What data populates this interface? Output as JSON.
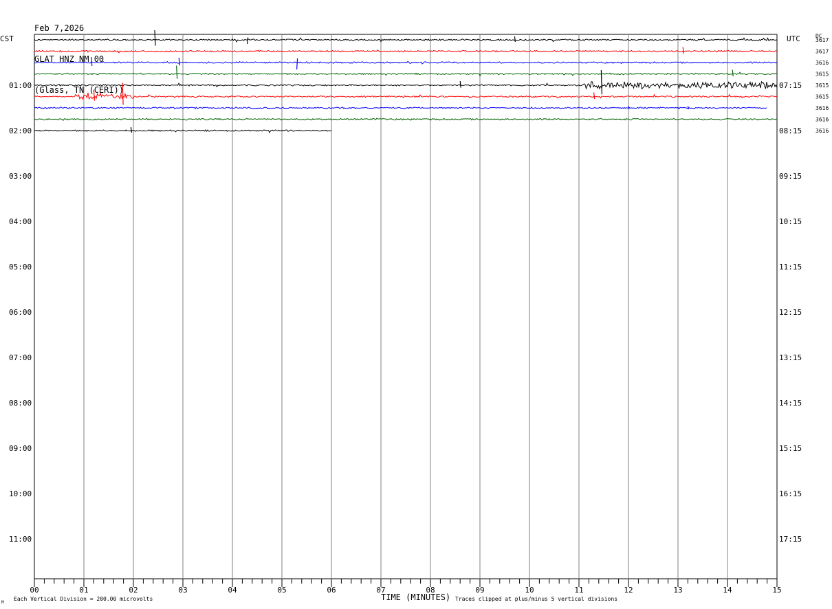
{
  "header": {
    "date": "Feb 7,2026",
    "station": "GLAT HNZ NM 00",
    "location": "(Glass, TN (CERI))"
  },
  "left_tz_label": "CST",
  "right_tz_label": "UTC",
  "dc_label": "DC",
  "x_axis_title": "TIME (MINUTES)",
  "footnote_left": "Each Vertical Division =  200.00 microvolts",
  "footnote_right": "Traces clipped at plus/minus 5 vertical divisions",
  "colors": {
    "black": "#000000",
    "red": "#ff0000",
    "blue": "#0000ff",
    "green": "#006400",
    "grid": "#808080"
  },
  "chart_data": {
    "type": "line",
    "xlabel": "TIME (MINUTES)",
    "xlim": [
      0,
      15
    ],
    "x_ticks": [
      "00",
      "01",
      "02",
      "03",
      "04",
      "05",
      "06",
      "07",
      "08",
      "09",
      "10",
      "11",
      "12",
      "13",
      "14",
      "15"
    ],
    "left_hour_labels": [
      "01:00",
      "02:00",
      "03:00",
      "04:00",
      "05:00",
      "06:00",
      "07:00",
      "08:00",
      "09:00",
      "10:00",
      "11:00"
    ],
    "right_hour_labels": [
      "07:15",
      "08:15",
      "09:15",
      "10:15",
      "11:15",
      "12:15",
      "13:15",
      "14:15",
      "15:15",
      "16:15",
      "17:15"
    ],
    "trace_colors": [
      "black",
      "red",
      "blue",
      "green"
    ],
    "traces": [
      {
        "row": 0,
        "color": "black",
        "dc": "3617",
        "end_minute": 15,
        "events": [
          {
            "t": 2.43,
            "a": 14
          },
          {
            "t": 4.3,
            "a": -6
          },
          {
            "t": 9.7,
            "a": 5
          }
        ]
      },
      {
        "row": 1,
        "color": "red",
        "dc": "3617",
        "end_minute": 15,
        "events": [
          {
            "t": 13.1,
            "a": 6
          }
        ]
      },
      {
        "row": 2,
        "color": "blue",
        "dc": "3616",
        "end_minute": 15,
        "events": [
          {
            "t": 1.15,
            "a": 8
          },
          {
            "t": 2.92,
            "a": 7
          },
          {
            "t": 5.3,
            "a": -10
          }
        ]
      },
      {
        "row": 3,
        "color": "green",
        "dc": "3615",
        "end_minute": 15,
        "events": [
          {
            "t": 2.87,
            "a": 12
          },
          {
            "t": 14.1,
            "a": 6
          }
        ]
      },
      {
        "row": 4,
        "color": "black",
        "dc": "3615",
        "end_minute": 15,
        "events": [
          {
            "t": 8.6,
            "a": 6
          },
          {
            "t": 11.45,
            "a": 22
          }
        ],
        "burst": [
          11.1,
          15
        ]
      },
      {
        "row": 5,
        "color": "red",
        "dc": "3615",
        "end_minute": 15,
        "events": [
          {
            "t": 1.2,
            "a": 10
          },
          {
            "t": 1.78,
            "a": 20
          },
          {
            "t": 11.3,
            "a": 6
          }
        ],
        "burst": [
          0.8,
          2.0
        ]
      },
      {
        "row": 6,
        "color": "blue",
        "dc": "3616",
        "end_minute": 14.8,
        "events": [
          {
            "t": 12.0,
            "a": 3
          },
          {
            "t": 13.2,
            "a": 3
          }
        ]
      },
      {
        "row": 7,
        "color": "green",
        "dc": "3616",
        "end_minute": 15,
        "events": []
      },
      {
        "row": 8,
        "color": "black",
        "dc": "3616",
        "end_minute": 6.0,
        "events": [
          {
            "t": 1.95,
            "a": 5
          }
        ]
      }
    ]
  }
}
